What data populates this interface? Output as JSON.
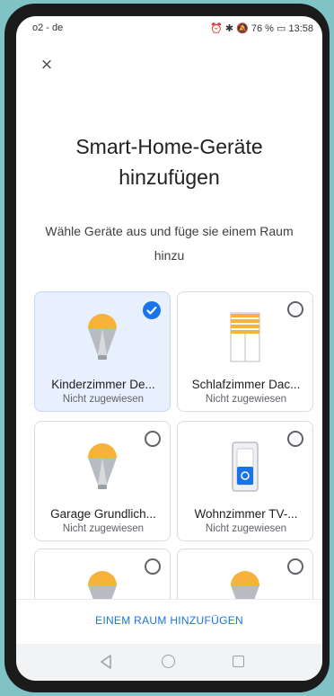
{
  "status_bar": {
    "carrier": "o2 - de",
    "right": "⏰ ✱ 🔕 76 % ▭ 13:58"
  },
  "header": {
    "title_line1": "Smart-Home-Geräte",
    "title_line2": "hinzufügen",
    "subtitle": "Wähle Geräte aus und füge sie einem Raum hinzu"
  },
  "devices": [
    {
      "name": "Kinderzimmer De...",
      "status": "Nicht zugewiesen",
      "icon": "bulb-icon",
      "selected": true
    },
    {
      "name": "Schlafzimmer Dac...",
      "status": "Nicht zugewiesen",
      "icon": "blinds-icon",
      "selected": false
    },
    {
      "name": "Garage Grundlich...",
      "status": "Nicht zugewiesen",
      "icon": "bulb-icon",
      "selected": false
    },
    {
      "name": "Wohnzimmer TV-...",
      "status": "Nicht zugewiesen",
      "icon": "switch-icon",
      "selected": false
    },
    {
      "name": "",
      "status": "",
      "icon": "bulb-icon",
      "selected": false
    },
    {
      "name": "",
      "status": "",
      "icon": "bulb-icon",
      "selected": false
    }
  ],
  "footer": {
    "add_room_label": "EINEM RAUM HINZUFÜGEN"
  },
  "colors": {
    "accent": "#1a73e8",
    "bulb_yellow": "#f6b23a",
    "selected_bg": "#e8f0fe"
  }
}
